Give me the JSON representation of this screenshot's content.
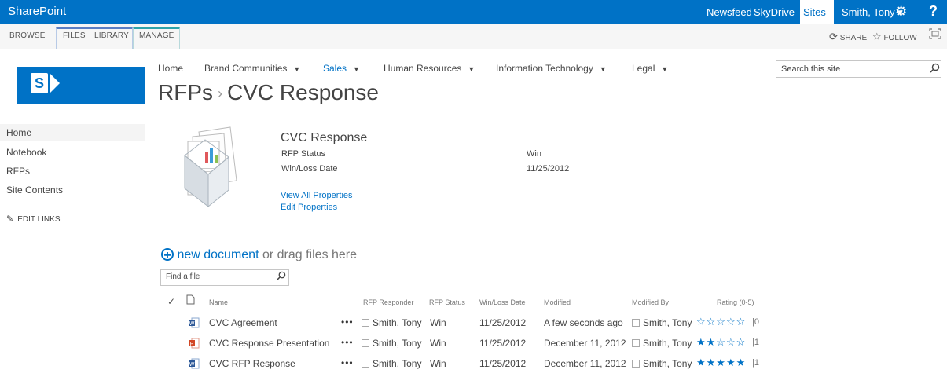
{
  "suite": {
    "brand": "SharePoint",
    "links": [
      "Newsfeed",
      "SkyDrive",
      "Sites"
    ],
    "user": "Smith, Tony ▾",
    "gear": "⚙",
    "help": "?"
  },
  "ribbon": {
    "tabs": [
      "BROWSE",
      "FILES",
      "LIBRARY",
      "MANAGE"
    ],
    "share": "SHARE",
    "follow": "FOLLOW"
  },
  "topnav": {
    "items": [
      "Home",
      "Brand Communities",
      "Sales",
      "Human Resources",
      "Information Technology",
      "Legal"
    ],
    "selected": "Sales"
  },
  "breadcrumb": {
    "parent": "RFPs",
    "current": "CVC Response"
  },
  "search": {
    "placeholder": "Search this site"
  },
  "quicklaunch": {
    "items": [
      "Home",
      "Notebook",
      "RFPs",
      "Site Contents"
    ],
    "edit_links": "EDIT LINKS"
  },
  "docset": {
    "title": "CVC Response",
    "props": [
      {
        "label": "RFP Status",
        "value": "Win"
      },
      {
        "label": "Win/Loss Date",
        "value": "11/25/2012"
      }
    ],
    "view_all": "View All Properties",
    "edit": "Edit Properties"
  },
  "newdoc": {
    "link": "new document",
    "rest": "or drag files here"
  },
  "find": {
    "placeholder": "Find a file"
  },
  "table": {
    "headers": [
      "Name",
      "RFP Responder",
      "RFP Status",
      "Win/Loss Date",
      "Modified",
      "Modified By",
      "Rating (0-5)"
    ],
    "rows": [
      {
        "icon": "word-doc-icon",
        "name": "CVC Agreement",
        "responder": "Smith, Tony",
        "status": "Win",
        "date": "11/25/2012",
        "modified": "A few seconds ago",
        "modified_by": "Smith, Tony",
        "rating": 0,
        "rating_count": "0"
      },
      {
        "icon": "powerpoint-doc-icon",
        "name": "CVC Response Presentation",
        "responder": "Smith, Tony",
        "status": "Win",
        "date": "11/25/2012",
        "modified": "December 11, 2012",
        "modified_by": "Smith, Tony",
        "rating": 2,
        "rating_count": "1"
      },
      {
        "icon": "word-doc-icon",
        "name": "CVC RFP Response",
        "responder": "Smith, Tony",
        "status": "Win",
        "date": "11/25/2012",
        "modified": "December 11, 2012",
        "modified_by": "Smith, Tony",
        "rating": 5,
        "rating_count": "1"
      }
    ]
  },
  "colors": {
    "accent": "#0072c6",
    "files_tab": "#5b7ec4",
    "manage_tab": "#2ea3a9"
  }
}
